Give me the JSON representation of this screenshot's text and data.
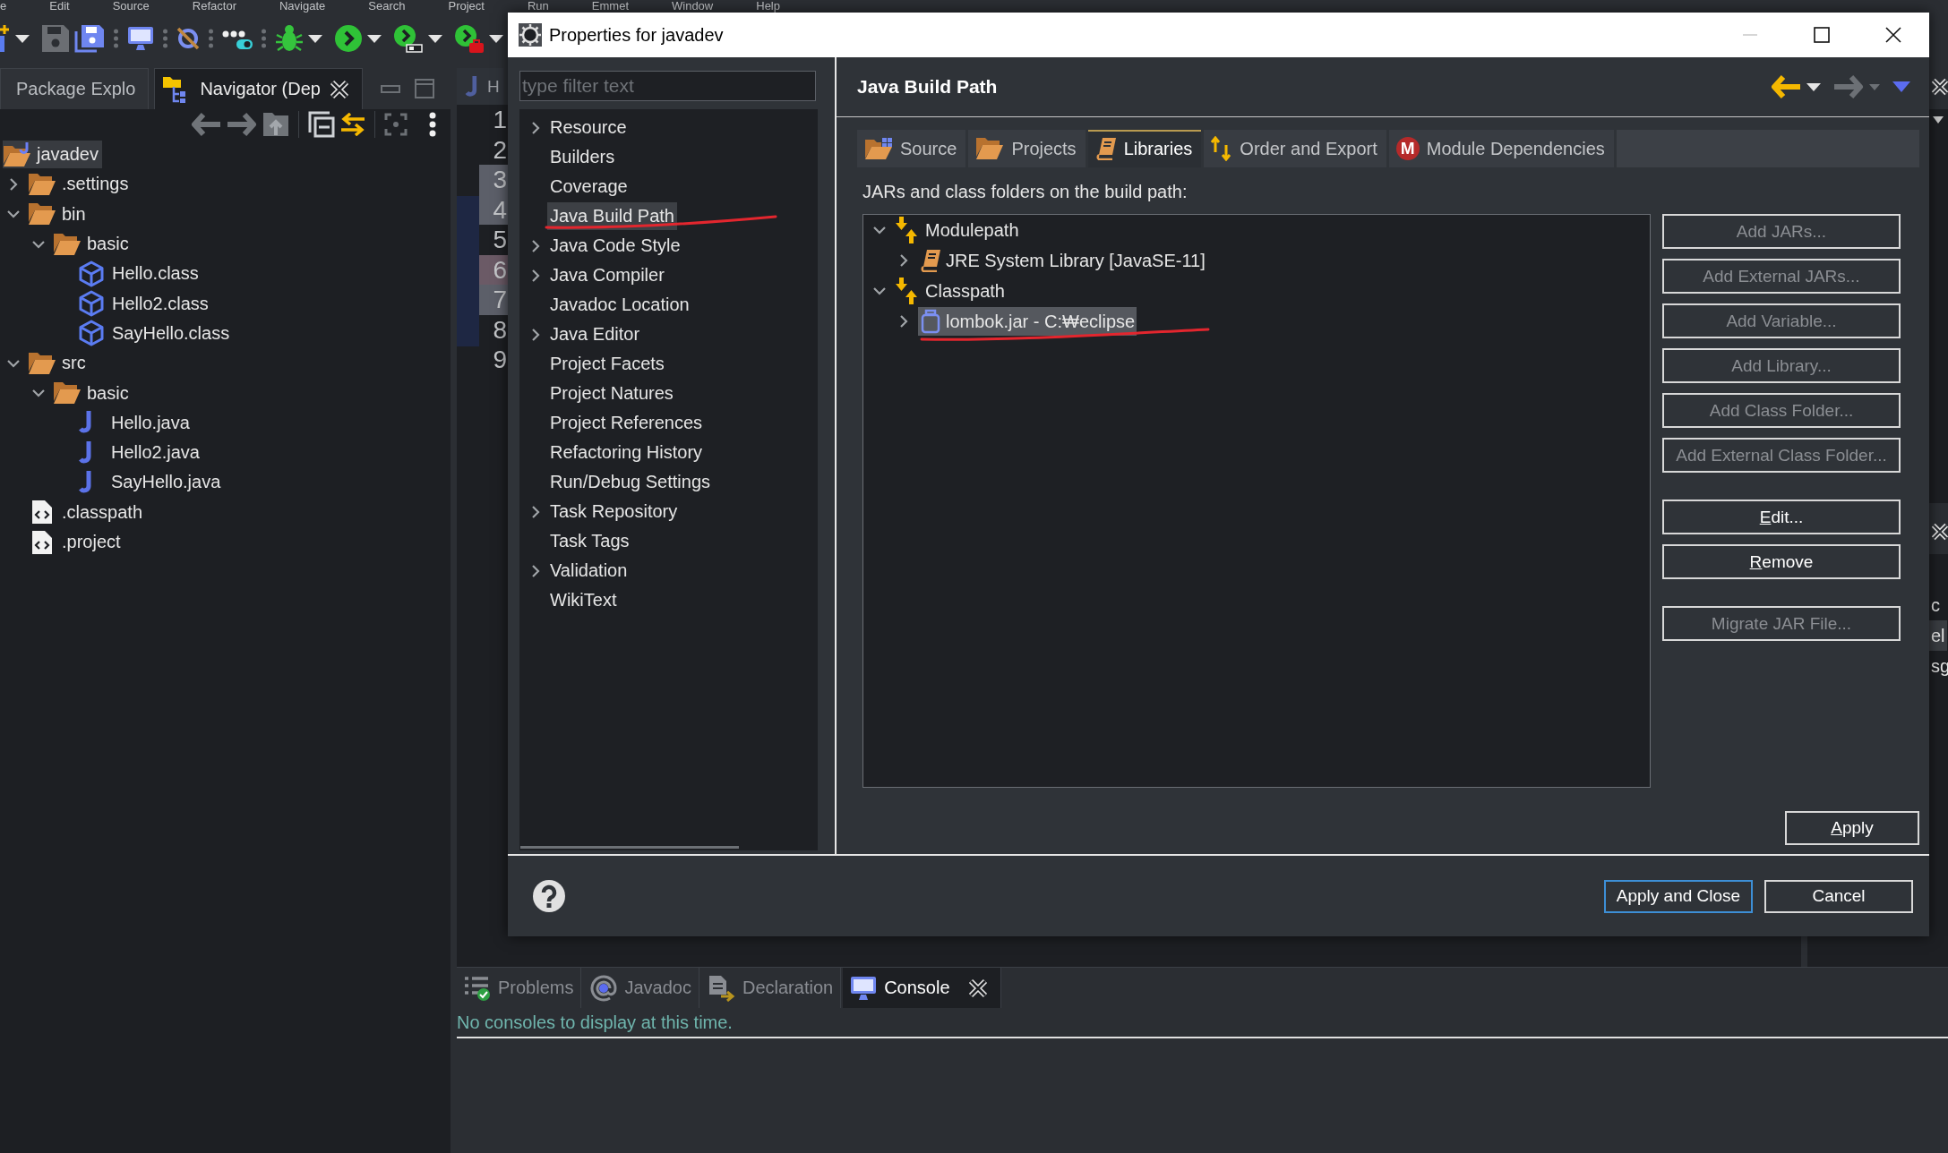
{
  "menu_bar": {
    "items": [
      "e",
      "Edit",
      "Source",
      "Refactor",
      "Navigate",
      "Search",
      "Project",
      "Run",
      "Emmet",
      "Window",
      "Help"
    ]
  },
  "left_panel": {
    "tabs": [
      {
        "label": "Package Explo",
        "selected": false
      },
      {
        "label": "Navigator (Dep",
        "selected": true
      }
    ],
    "tree": [
      {
        "label": "javadev",
        "kind": "project",
        "selected": true,
        "children": [
          {
            "label": ".settings",
            "kind": "folder",
            "expanded": false,
            "selected": false
          },
          {
            "label": "bin",
            "kind": "folder",
            "expanded": true,
            "selected": false,
            "children": [
              {
                "label": "basic",
                "kind": "folder",
                "expanded": true,
                "selected": false,
                "children": [
                  {
                    "label": "Hello.class",
                    "kind": "class",
                    "selected": false
                  },
                  {
                    "label": "Hello2.class",
                    "kind": "class",
                    "selected": false
                  },
                  {
                    "label": "SayHello.class",
                    "kind": "class",
                    "selected": false
                  }
                ]
              }
            ]
          },
          {
            "label": "src",
            "kind": "folder",
            "expanded": true,
            "selected": false,
            "children": [
              {
                "label": "basic",
                "kind": "folder",
                "expanded": true,
                "selected": false,
                "children": [
                  {
                    "label": "Hello.java",
                    "kind": "java",
                    "selected": false
                  },
                  {
                    "label": "Hello2.java",
                    "kind": "java",
                    "selected": false
                  },
                  {
                    "label": "SayHello.java",
                    "kind": "java",
                    "selected": false
                  }
                ]
              }
            ]
          },
          {
            "label": ".classpath",
            "kind": "xml",
            "selected": false
          },
          {
            "label": ".project",
            "kind": "xml",
            "selected": false
          }
        ]
      }
    ]
  },
  "editor": {
    "tab_label": "H",
    "line_numbers": [
      {
        "number": "1"
      },
      {
        "number": "2"
      },
      {
        "number": "3",
        "color": "#5c5f69"
      },
      {
        "number": "4",
        "color": "#5c5f69"
      },
      {
        "number": "5"
      },
      {
        "number": "6",
        "color": "#6b5a66"
      },
      {
        "number": "7",
        "color": "#5c5f69"
      },
      {
        "number": "8"
      },
      {
        "number": "9"
      }
    ]
  },
  "side_panel": {
    "lines": [
      {
        "text": "c",
        "selected": false
      },
      {
        "text": "el",
        "selected": true
      },
      {
        "text": "sg",
        "selected": false
      }
    ]
  },
  "bottom_panel": {
    "tabs": [
      {
        "label": "Problems",
        "kind": "problems",
        "selected": false
      },
      {
        "label": "Javadoc",
        "kind": "javadoc",
        "selected": false
      },
      {
        "label": "Declaration",
        "kind": "declaration",
        "selected": false
      },
      {
        "label": "Console",
        "kind": "console",
        "selected": true
      }
    ],
    "message": "No consoles to display at this time."
  },
  "dialog": {
    "title": "Properties for javadev",
    "filter": {
      "placeholder": "type filter text"
    },
    "categories": [
      {
        "label": "Resource",
        "expanded": false,
        "selected": false,
        "marked": false
      },
      {
        "label": "Builders",
        "selected": false,
        "marked": false
      },
      {
        "label": "Coverage",
        "selected": false,
        "marked": false
      },
      {
        "label": "Java Build Path",
        "selected": true,
        "marked": true
      },
      {
        "label": "Java Code Style",
        "expanded": false,
        "selected": false,
        "marked": false
      },
      {
        "label": "Java Compiler",
        "expanded": false,
        "selected": false,
        "marked": false
      },
      {
        "label": "Javadoc Location",
        "selected": false,
        "marked": false
      },
      {
        "label": "Java Editor",
        "expanded": false,
        "selected": false,
        "marked": false
      },
      {
        "label": "Project Facets",
        "selected": false,
        "marked": false
      },
      {
        "label": "Project Natures",
        "selected": false,
        "marked": false
      },
      {
        "label": "Project References",
        "selected": false,
        "marked": false
      },
      {
        "label": "Refactoring History",
        "selected": false,
        "marked": false
      },
      {
        "label": "Run/Debug Settings",
        "selected": false,
        "marked": false
      },
      {
        "label": "Task Repository",
        "expanded": false,
        "selected": false,
        "marked": false
      },
      {
        "label": "Task Tags",
        "selected": false,
        "marked": false
      },
      {
        "label": "Validation",
        "expanded": false,
        "selected": false,
        "marked": false
      },
      {
        "label": "WikiText",
        "selected": false,
        "marked": false
      }
    ],
    "page": {
      "title": "Java Build Path",
      "tabs": [
        {
          "label": "Source",
          "kind": "source",
          "selected": false
        },
        {
          "label": "Projects",
          "kind": "projects",
          "selected": false
        },
        {
          "label": "Libraries",
          "kind": "libraries",
          "selected": true
        },
        {
          "label": "Order and Export",
          "kind": "order",
          "selected": false
        },
        {
          "label": "Module Dependencies",
          "kind": "modules",
          "badge": "M",
          "selected": false
        }
      ],
      "caption": "JARs and class folders on the build path:",
      "tree": [
        {
          "label": "Modulepath",
          "kind": "container",
          "expanded": true,
          "selected": false,
          "marked": false,
          "children": [
            {
              "label": "JRE System Library [JavaSE-11]",
              "kind": "library",
              "expanded": false,
              "selected": false,
              "marked": false
            }
          ]
        },
        {
          "label": "Classpath",
          "kind": "container",
          "expanded": true,
          "selected": false,
          "marked": false,
          "children": [
            {
              "label": "lombok.jar - C:₩eclipse",
              "kind": "jar",
              "expanded": false,
              "selected": true,
              "marked": true
            }
          ]
        }
      ],
      "button_groups": [
        {
          "buttons": [
            {
              "label": "Add JARs...",
              "disabled": true,
              "mnemonic": false
            },
            {
              "label": "Add External JARs...",
              "disabled": true,
              "mnemonic": false
            },
            {
              "label": "Add Variable...",
              "disabled": true,
              "mnemonic": false
            },
            {
              "label": "Add Library...",
              "disabled": true,
              "mnemonic": false
            },
            {
              "label": "Add Class Folder...",
              "disabled": true,
              "mnemonic": false
            },
            {
              "label": "Add External Class Folder...",
              "disabled": true,
              "mnemonic": false
            }
          ]
        },
        {
          "buttons": [
            {
              "label": "Edit...",
              "disabled": false,
              "mnemonic": true
            },
            {
              "label": "Remove",
              "disabled": false,
              "mnemonic": true
            }
          ]
        },
        {
          "buttons": [
            {
              "label": "Migrate JAR File...",
              "disabled": true,
              "mnemonic": false
            }
          ]
        }
      ],
      "apply": {
        "label": "Apply",
        "mnemonic": true
      }
    },
    "footer_buttons": [
      {
        "label": "Apply and Close",
        "focused": true,
        "mnemonic": false
      },
      {
        "label": "Cancel",
        "focused": false,
        "mnemonic": false
      }
    ]
  }
}
